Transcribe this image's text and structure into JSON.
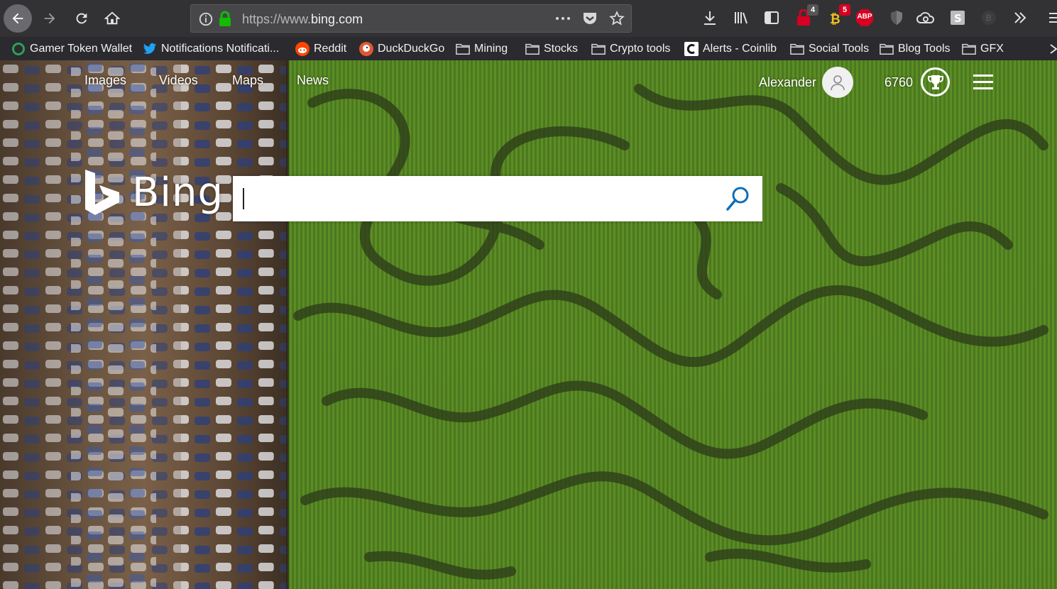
{
  "browser": {
    "url_prefix": "https://www.",
    "url_host": "bing.com",
    "badges": {
      "lock_addon": "4",
      "ext_five": "5",
      "abp": "ABP"
    }
  },
  "bookmarks": [
    {
      "label": "Gamer Token Wallet",
      "icon": "circle-icon"
    },
    {
      "label": "Notifications Notificati...",
      "icon": "twitter-icon"
    },
    {
      "label": "Reddit",
      "icon": "reddit-icon"
    },
    {
      "label": "DuckDuckGo",
      "icon": "duckduckgo-icon"
    },
    {
      "label": "Mining",
      "icon": "folder-icon"
    },
    {
      "label": "Stocks",
      "icon": "folder-icon"
    },
    {
      "label": "Crypto tools",
      "icon": "folder-icon"
    },
    {
      "label": "Alerts - Coinlib",
      "icon": "coinlib-icon"
    },
    {
      "label": "Social Tools",
      "icon": "folder-icon"
    },
    {
      "label": "Blog Tools",
      "icon": "folder-icon"
    },
    {
      "label": "GFX",
      "icon": "folder-icon"
    }
  ],
  "bing": {
    "nav": [
      "Images",
      "Videos",
      "Maps",
      "News"
    ],
    "user_name": "Alexander",
    "points": "6760",
    "logo_text": "Bing",
    "search_value": ""
  },
  "colors": {
    "toolbar": "#323234",
    "bookmarks_bar": "#2b2a2e",
    "search_icon": "#0e6eb8",
    "badge_red": "#d70022"
  }
}
